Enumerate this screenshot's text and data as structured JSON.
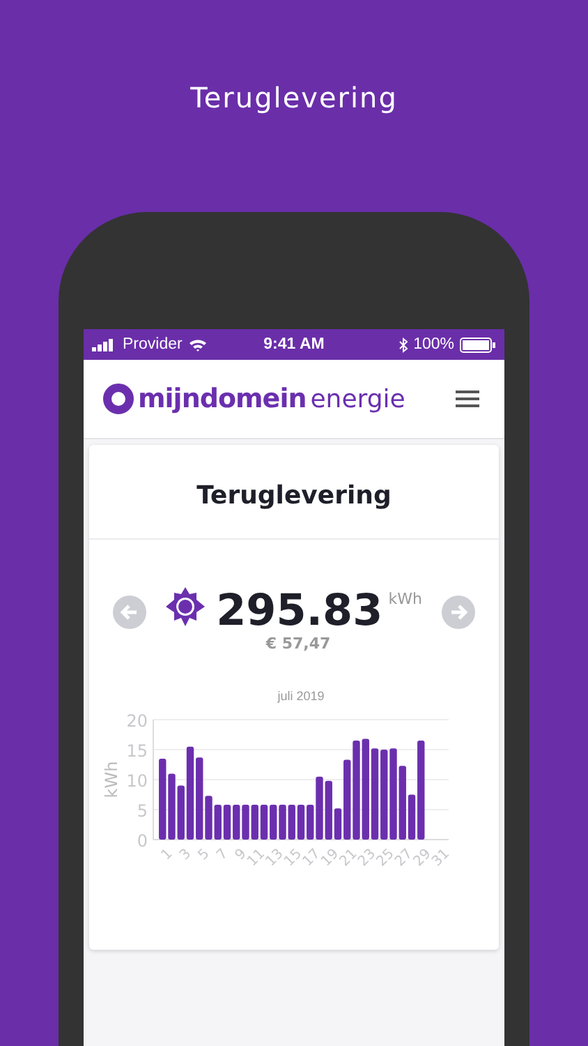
{
  "page_title": "Teruglevering",
  "status_bar": {
    "carrier": "Provider",
    "time": "9:41 AM",
    "battery": "100%"
  },
  "header": {
    "brand_bold": "mijndomein",
    "brand_light": "energie"
  },
  "card": {
    "title": "Teruglevering",
    "value": "295.83",
    "unit": "kWh",
    "amount": "€ 57,47",
    "chart_data": {
      "type": "bar",
      "title": "juli 2019",
      "ylabel": "kWh",
      "x": [
        1,
        2,
        3,
        4,
        5,
        6,
        7,
        8,
        9,
        10,
        11,
        12,
        13,
        14,
        15,
        16,
        17,
        18,
        19,
        20,
        21,
        22,
        23,
        24,
        25,
        26,
        27,
        28,
        29
      ],
      "xlim": [
        0,
        32
      ],
      "grid": true,
      "series": [
        {
          "color": "#6b2fae",
          "values": [
            13.5,
            11,
            9,
            15.5,
            13.7,
            7.3,
            5.8,
            5.8,
            5.8,
            5.8,
            5.8,
            5.8,
            5.8,
            5.8,
            5.8,
            5.8,
            5.8,
            10.5,
            9.8,
            5.2,
            13.3,
            16.5,
            16.8,
            15.2,
            15,
            15.2,
            12.3,
            7.5,
            16.5
          ]
        }
      ],
      "ylim": [
        0,
        20
      ],
      "yticks": [
        0,
        5,
        10,
        15,
        20
      ],
      "xticks": [
        1,
        3,
        5,
        7,
        9,
        11,
        13,
        15,
        17,
        19,
        21,
        23,
        25,
        27,
        29,
        31
      ]
    }
  }
}
